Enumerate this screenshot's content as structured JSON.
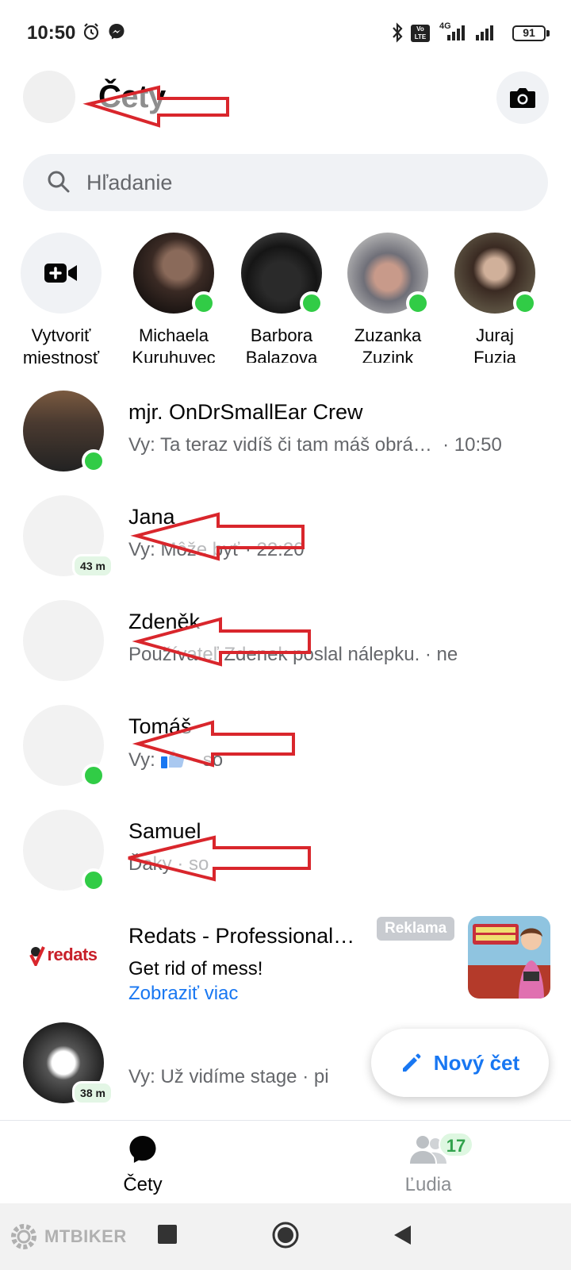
{
  "status_bar": {
    "time": "10:50",
    "network_label": "4G",
    "volte_label": "Vo LTE",
    "battery": "91"
  },
  "header": {
    "title": "Čety"
  },
  "search": {
    "placeholder": "Hľadanie"
  },
  "stories": [
    {
      "name": "Vytvoriť",
      "sub": "miestnosť",
      "type": "create",
      "icon": "video-plus-icon"
    },
    {
      "name": "Michaela",
      "sub": "Kuruhuvec",
      "online": true
    },
    {
      "name": "Barbora",
      "sub": "Balazova",
      "online": true
    },
    {
      "name": "Zuzanka",
      "sub": "Zuzink",
      "online": true
    },
    {
      "name": "Juraj",
      "sub": "Fuzia",
      "online": true
    }
  ],
  "chats": [
    {
      "name": "mjr. OnDrSmallEar Crew",
      "preview": "Vy: Ta teraz vidíš či tam máš obrá…",
      "time": "· 10:50",
      "online": true
    },
    {
      "name": "Jana",
      "preview": "Vy: Môže byť · 22:20",
      "badge": "43 m"
    },
    {
      "name": "Zdeněk",
      "preview": "Používateľ Zdenek poslal nálepku. · ne"
    },
    {
      "name": "Tomáš",
      "preview": "Vy:",
      "preview_suffix": "· so",
      "online": true
    },
    {
      "name": "Samuel",
      "preview": "Ďaky · so",
      "online": true
    },
    {
      "name": "Redats - Professional…",
      "preview": "Get rid of mess!",
      "ad_label": "Reklama",
      "link": "Zobraziť viac",
      "logo_text": "redats"
    },
    {
      "name": "",
      "preview": "Vy: Už vidíme stage · pi",
      "badge": "38 m"
    }
  ],
  "fab": {
    "label": "Nový čet",
    "icon": "pencil-icon"
  },
  "tabs": [
    {
      "label": "Čety",
      "icon": "chat-bubble-icon",
      "active": true
    },
    {
      "label": "Ľudia",
      "icon": "people-icon",
      "badge": "17"
    }
  ],
  "watermark": "MTBIKER",
  "colors": {
    "accent": "#1877f2",
    "online": "#31cc46",
    "annotation_arrow": "#d9262c"
  }
}
